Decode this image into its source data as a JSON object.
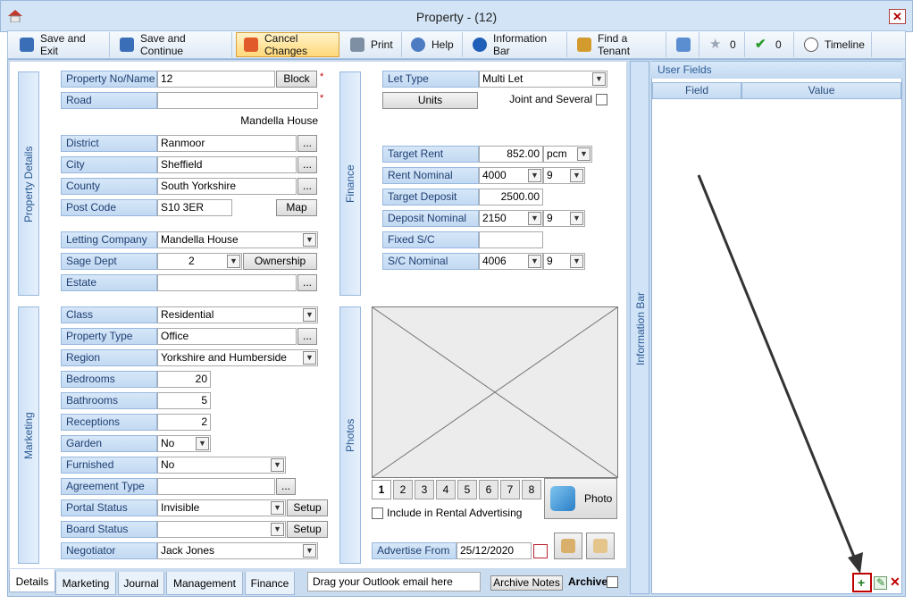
{
  "window": {
    "title": "Property  - (12)",
    "close": "✕"
  },
  "toolbar": {
    "save_exit": "Save and Exit",
    "save_continue": "Save and Continue",
    "cancel": "Cancel Changes",
    "print": "Print",
    "help": "Help",
    "info_bar": "Information Bar",
    "find_tenant": "Find a Tenant",
    "stars": "0",
    "checks": "0",
    "timeline": "Timeline"
  },
  "sections": {
    "property_details": "Property Details",
    "finance": "Finance",
    "marketing": "Marketing",
    "photos": "Photos",
    "information_bar": "Information Bar"
  },
  "property": {
    "no_label": "Property No/Name",
    "no_value": "12",
    "block_btn": "Block",
    "road_label": "Road",
    "road_value": "",
    "address_line": "Mandella House",
    "district_label": "District",
    "district_value": "Ranmoor",
    "city_label": "City",
    "city_value": "Sheffield",
    "county_label": "County",
    "county_value": "South Yorkshire",
    "postcode_label": "Post Code",
    "postcode_value": "S10 3ER",
    "map_btn": "Map",
    "letting_label": "Letting Company",
    "letting_value": "Mandella House",
    "sage_label": "Sage Dept",
    "sage_value": "2",
    "ownership_btn": "Ownership",
    "estate_label": "Estate",
    "estate_value": "",
    "ellipsis": "...",
    "required": "*"
  },
  "marketing": {
    "class_label": "Class",
    "class_value": "Residential",
    "ptype_label": "Property Type",
    "ptype_value": "Office",
    "region_label": "Region",
    "region_value": "Yorkshire and Humberside",
    "bedrooms_label": "Bedrooms",
    "bedrooms_value": "20",
    "bathrooms_label": "Bathrooms",
    "bathrooms_value": "5",
    "receptions_label": "Receptions",
    "receptions_value": "2",
    "garden_label": "Garden",
    "garden_value": "No",
    "furnished_label": "Furnished",
    "furnished_value": "No",
    "agreement_label": "Agreement Type",
    "agreement_value": "",
    "portal_label": "Portal Status",
    "portal_value": "Invisible",
    "board_label": "Board Status",
    "board_value": "",
    "negotiator_label": "Negotiator",
    "negotiator_value": "Jack Jones",
    "setup_btn": "Setup"
  },
  "finance": {
    "let_type_label": "Let Type",
    "let_type_value": "Multi Let",
    "units_btn": "Units",
    "joint_label": "Joint and Several",
    "target_rent_label": "Target Rent",
    "target_rent_value": "852.00",
    "target_rent_period": "pcm",
    "rent_nominal_label": "Rent Nominal",
    "rent_nominal_value": "4000",
    "rent_nominal_sub": "9",
    "target_deposit_label": "Target Deposit",
    "target_deposit_value": "2500.00",
    "deposit_nominal_label": "Deposit Nominal",
    "deposit_nominal_value": "2150",
    "deposit_nominal_sub": "9",
    "fixed_sc_label": "Fixed S/C",
    "fixed_sc_value": "",
    "sc_nominal_label": "S/C Nominal",
    "sc_nominal_value": "4006",
    "sc_nominal_sub": "9"
  },
  "photos": {
    "numbers": [
      "1",
      "2",
      "3",
      "4",
      "5",
      "6",
      "7",
      "8"
    ],
    "photo_btn": "Photo",
    "include_label": "Include in  Rental Advertising",
    "advertise_label": "Advertise From",
    "advertise_value": "25/12/2020"
  },
  "tabs": [
    "Details",
    "Marketing",
    "Journal",
    "Management",
    "Finance"
  ],
  "bottom": {
    "outlook": "Drag your Outlook email here",
    "archive_notes": "Archive Notes",
    "archive": "Archive"
  },
  "user_fields": {
    "title": "User Fields",
    "col_field": "Field",
    "col_value": "Value"
  },
  "colors": {
    "label_bg": "#c8dcf2",
    "accent": "#2a5a95",
    "highlight_border": "#c00000"
  }
}
